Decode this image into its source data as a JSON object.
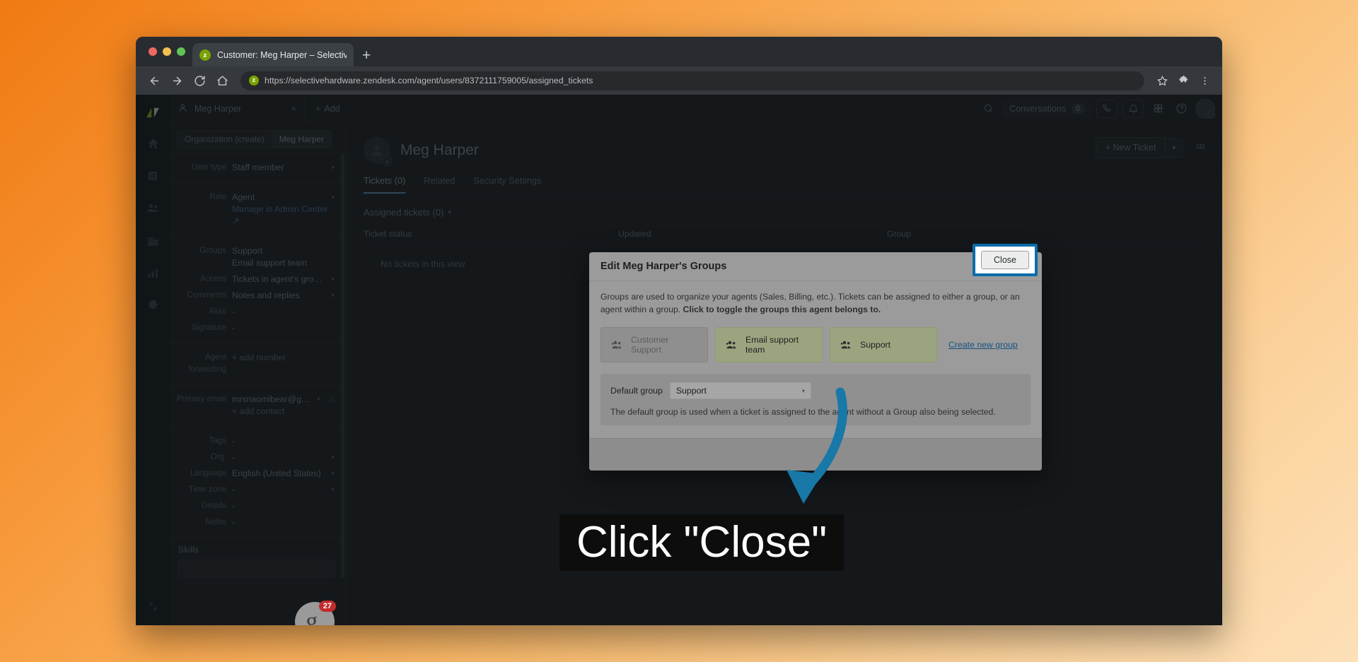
{
  "browser": {
    "tab_title": "Customer: Meg Harper – Selectiv",
    "favicon_letter": "z",
    "new_tab_label": "+",
    "url": "https://selectivehardware.zendesk.com/agent/users/8372111759005/assigned_tickets",
    "back_icon": "back-arrow-icon",
    "forward_icon": "forward-arrow-icon",
    "reload_icon": "reload-icon",
    "home_icon": "home-icon",
    "bookmark_icon": "star-icon",
    "extensions_icon": "puzzle-icon",
    "menu_icon": "kebab-menu-icon"
  },
  "rail": {
    "items": [
      {
        "name": "home",
        "icon": "home-icon"
      },
      {
        "name": "views",
        "icon": "views-icon"
      },
      {
        "name": "customers",
        "icon": "customers-icon"
      },
      {
        "name": "organizations",
        "icon": "organizations-icon"
      },
      {
        "name": "reporting",
        "icon": "reporting-icon"
      },
      {
        "name": "admin",
        "icon": "gear-icon"
      }
    ]
  },
  "top_bar": {
    "ticket_tab_label": "Meg Harper",
    "ticket_tab_close": "×",
    "add_label": "Add",
    "add_plus": "+",
    "search_icon": "search-icon",
    "conversations_label": "Conversations",
    "conversations_count": "0",
    "talk_icon": "phone-icon",
    "notifications_icon": "bell-icon",
    "apps_icon": "apps-grid-icon",
    "help_icon": "help-icon",
    "avatar_icon": "avatar-icon"
  },
  "user_panel": {
    "tabs": [
      {
        "label": "Organization (create)",
        "active": false
      },
      {
        "label": "Meg Harper",
        "active": true
      }
    ],
    "fields": [
      {
        "label": "User type",
        "value": "Staff member",
        "caret": true
      },
      {
        "label": "Role",
        "value": "Agent",
        "caret": true,
        "sub": "Manage in Admin Center",
        "sub_link": true,
        "external_icon": "external-link-icon"
      },
      {
        "label": "Groups",
        "value": "Support",
        "caret": false,
        "sub": "Email support team"
      },
      {
        "label": "Access",
        "value": "Tickets in agent's groups",
        "caret": true
      },
      {
        "label": "Comments",
        "value": "Notes and replies",
        "caret": true
      },
      {
        "label": "Alias",
        "value": "-",
        "caret": false
      },
      {
        "label": "Signature",
        "value": "-",
        "caret": false
      },
      {
        "label": "Agent forwarding",
        "value": "+ add number",
        "caret": false,
        "muted": true
      },
      {
        "label": "Primary email",
        "value": "mrsnaomibear@gmail.com",
        "caret": true,
        "sub": "+ add contact",
        "sub_muted": true,
        "warning_icon": "warning-icon"
      },
      {
        "label": "Tags",
        "value": "-",
        "caret": false
      },
      {
        "label": "Org.",
        "value": "-",
        "caret": true
      },
      {
        "label": "Language",
        "value": "English (United States)",
        "caret": true
      },
      {
        "label": "Time zone",
        "value": "-",
        "caret": true
      },
      {
        "label": "Details",
        "value": "-",
        "caret": false
      },
      {
        "label": "Notes",
        "value": "-",
        "caret": false
      }
    ],
    "skills_label": "Skills"
  },
  "main": {
    "user_name": "Meg Harper",
    "avatar_icon": "user-avatar-icon",
    "avatar_badge_icon": "agent-badge-icon",
    "new_ticket_label": "+ New Ticket",
    "new_ticket_caret": "▾",
    "apps_grid_icon": "apps-grid-icon",
    "tabs": [
      {
        "label": "Tickets (0)",
        "active": true
      },
      {
        "label": "Related",
        "active": false
      },
      {
        "label": "Security Settings",
        "active": false
      }
    ],
    "assigned_title": "Assigned tickets (0)",
    "assigned_caret": "▾",
    "columns": [
      "Ticket status",
      "Updated",
      "Group"
    ],
    "empty_message": "No tickets in this view"
  },
  "modal": {
    "title": "Edit Meg Harper's Groups",
    "close_icon": "×",
    "description_part1": "Groups are used to organize your agents (Sales, Billing, etc.). Tickets can be assigned to either a group, or an agent within a group. ",
    "description_bold": "Click to toggle the groups this agent belongs to.",
    "groups": [
      {
        "label": "Customer Support",
        "selected": false,
        "icon": "group-icon"
      },
      {
        "label": "Email support team",
        "selected": true,
        "icon": "group-icon"
      },
      {
        "label": "Support",
        "selected": true,
        "icon": "group-icon"
      }
    ],
    "create_group_link": "Create new group",
    "default_group_label": "Default group",
    "default_group_value": "Support",
    "default_group_caret": "▾",
    "default_group_help": "The default group is used when a ticket is assigned to the agent without a Group also being selected.",
    "close_button_label": "Close"
  },
  "annotation": {
    "caption": "Click \"Close\"",
    "arrow_color": "#1878a8",
    "highlight_color": "#0b6ca8"
  },
  "widget": {
    "letter": "g.",
    "badge": "27"
  }
}
